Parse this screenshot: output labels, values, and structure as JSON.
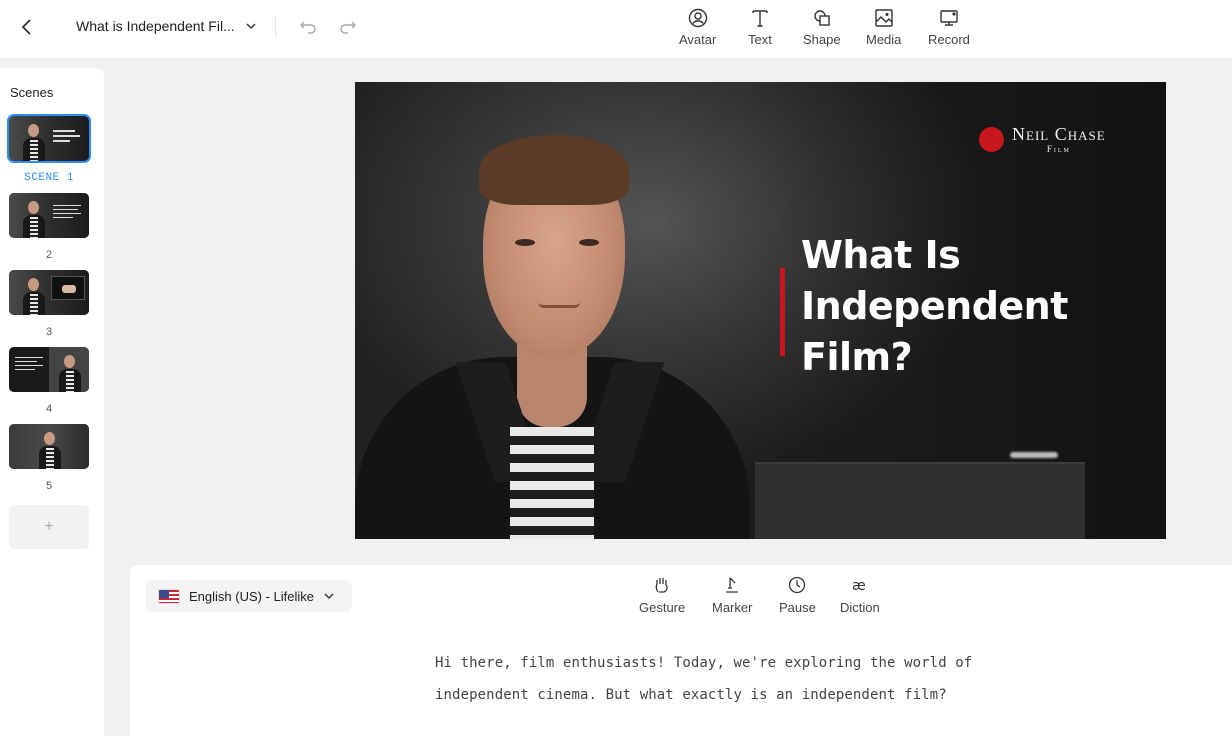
{
  "header": {
    "doc_title": "What is Independent Fil...",
    "tools": [
      {
        "label": "Avatar",
        "icon": "avatar-icon"
      },
      {
        "label": "Text",
        "icon": "text-icon"
      },
      {
        "label": "Shape",
        "icon": "shape-icon"
      },
      {
        "label": "Media",
        "icon": "media-icon"
      },
      {
        "label": "Record",
        "icon": "record-icon"
      }
    ]
  },
  "scenes": {
    "title": "Scenes",
    "items": [
      {
        "label": "SCENE 1",
        "active": true
      },
      {
        "label": "2",
        "active": false
      },
      {
        "label": "3",
        "active": false
      },
      {
        "label": "4",
        "active": false
      },
      {
        "label": "5",
        "active": false
      }
    ],
    "add_label": "+"
  },
  "canvas": {
    "brand_name": "Neil Chase",
    "brand_sub": "Film",
    "headline": "What Is\nIndependent\nFilm?",
    "accent_color": "#c8161d"
  },
  "script": {
    "voice": "English (US) - Lifelike",
    "tools": [
      {
        "label": "Gesture",
        "icon": "gesture-icon"
      },
      {
        "label": "Marker",
        "icon": "marker-icon"
      },
      {
        "label": "Pause",
        "icon": "pause-icon"
      },
      {
        "label": "Diction",
        "icon": "diction-icon"
      }
    ],
    "text": "Hi there, film enthusiasts! Today, we're exploring the world of independent cinema. But what exactly is an independent film?"
  }
}
